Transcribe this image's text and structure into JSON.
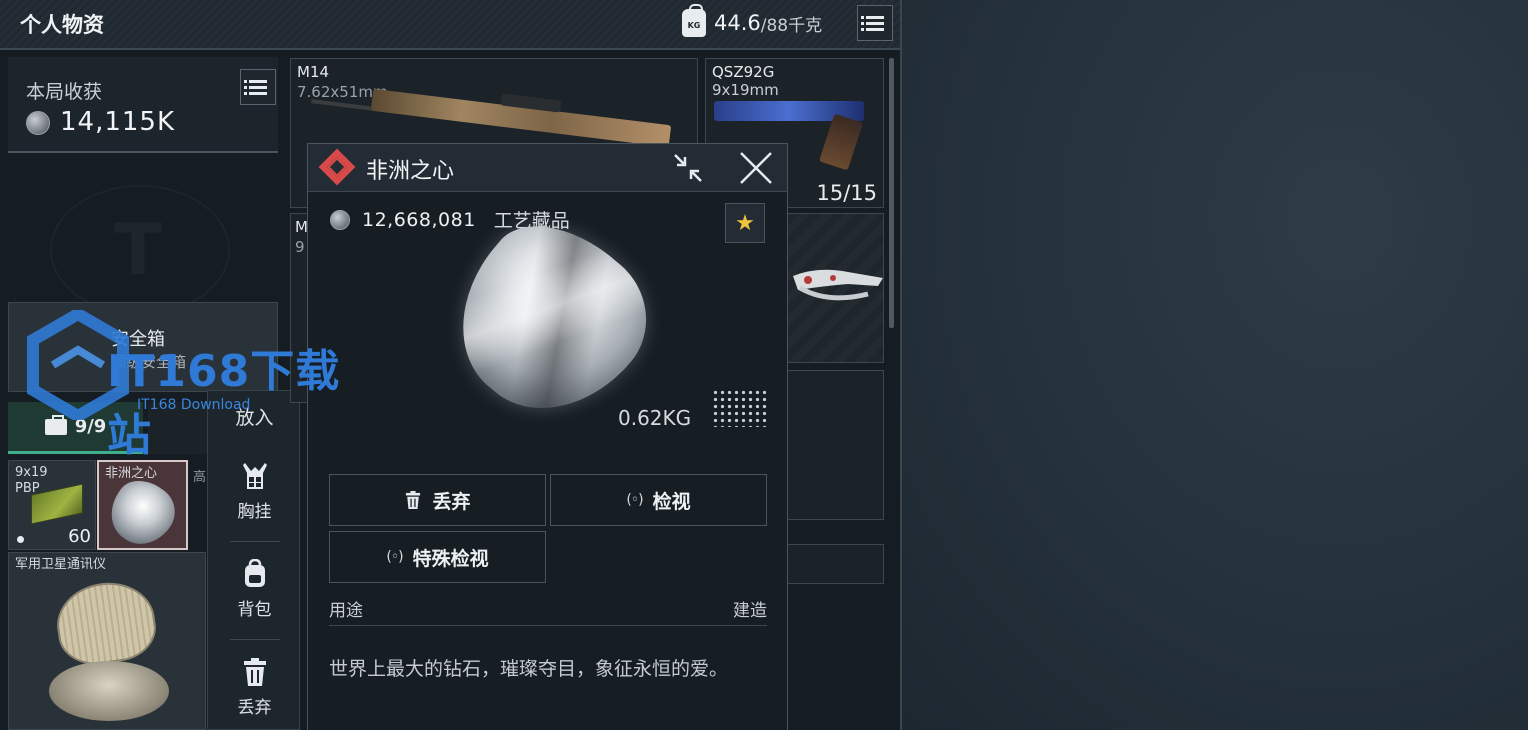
{
  "header": {
    "title": "个人物资",
    "weight_current": "44.6",
    "weight_max": "/88千克",
    "kg_icon_text": "KG",
    "menu_icon": "list-icon"
  },
  "earnings": {
    "label": "本局收获",
    "value": "14,115K"
  },
  "safe_box": {
    "name": "安全箱",
    "sub": "顶级安全箱"
  },
  "tabs": {
    "case_count": "9/9"
  },
  "slots": {
    "ammo": {
      "name_line1": "9x19",
      "name_line2": "PBP",
      "count": "60"
    },
    "heart": {
      "name": "非洲之心"
    },
    "high_label": "高",
    "satellite": {
      "name": "军用卫星通讯仪"
    }
  },
  "context_menu": {
    "put": "放入",
    "items": [
      {
        "label": "胸挂",
        "icon": "chest-rig-icon"
      },
      {
        "label": "背包",
        "icon": "backpack-icon"
      },
      {
        "label": "丢弃",
        "icon": "trash-icon"
      }
    ]
  },
  "weapons": {
    "m14": {
      "name": "M14",
      "caliber": "7.62x51mm"
    },
    "qsz92g": {
      "name": "QSZ92G",
      "caliber": "9x19mm",
      "ammo": "15/15"
    },
    "mid": {
      "name": "M",
      "caliber": "9"
    }
  },
  "popup": {
    "title": "非洲之心",
    "price": "12,668,081",
    "category": "工艺藏品",
    "weight": "0.62KG",
    "buttons": {
      "drop": "丢弃",
      "inspect": "检视",
      "special_inspect": "特殊检视"
    },
    "use_label": "用途",
    "build_label": "建造",
    "description": "世界上最大的钻石，璀璨夺目，象征永恒的爱。"
  },
  "watermark": {
    "text": "IT168下载站",
    "sub": "IT168 Download"
  },
  "colors": {
    "accent_green": "#3fae8a",
    "diamond_red": "#d84a4a",
    "star_gold": "#f0c43a",
    "watermark_blue": "#2f7ad6"
  }
}
